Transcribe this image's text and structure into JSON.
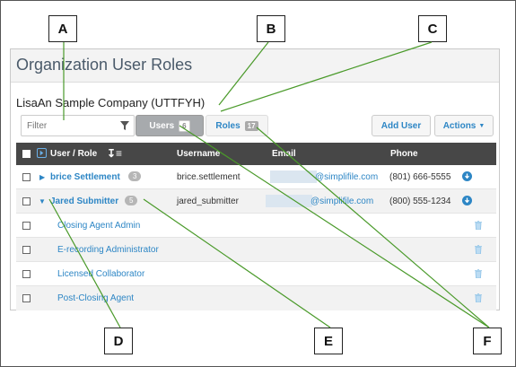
{
  "callouts": [
    "A",
    "B",
    "C",
    "D",
    "E",
    "F"
  ],
  "panel": {
    "title": "Organization User Roles",
    "company": "LisaAn Sample Company (UTTFYH)",
    "filter_placeholder": "Filter",
    "tabs": [
      {
        "label": "Users",
        "count": "6"
      },
      {
        "label": "Roles",
        "count": "17"
      }
    ],
    "add_user_label": "Add User",
    "actions_label": "Actions"
  },
  "table": {
    "headers": {
      "user_role": "User / Role",
      "username": "Username",
      "email": "Email",
      "phone": "Phone"
    },
    "users": [
      {
        "name": "brice Settlement",
        "count": "3",
        "username": "brice.settlement",
        "email": "@simplifile.com",
        "phone": "(801) 666-5555"
      },
      {
        "name": "Jared Submitter",
        "count": "5",
        "username": "jared_submitter",
        "email": "@simplifile.com",
        "phone": "(800) 555-1234"
      }
    ],
    "roles": [
      {
        "label": "Closing Agent Admin"
      },
      {
        "label": "E-recording Administrator"
      },
      {
        "label": "Licensed Collaborator"
      },
      {
        "label": "Post-Closing Agent"
      }
    ]
  },
  "colors": {
    "accent": "#2d86c5",
    "header_bg": "#474747",
    "callout_line": "#4a9a2a"
  }
}
